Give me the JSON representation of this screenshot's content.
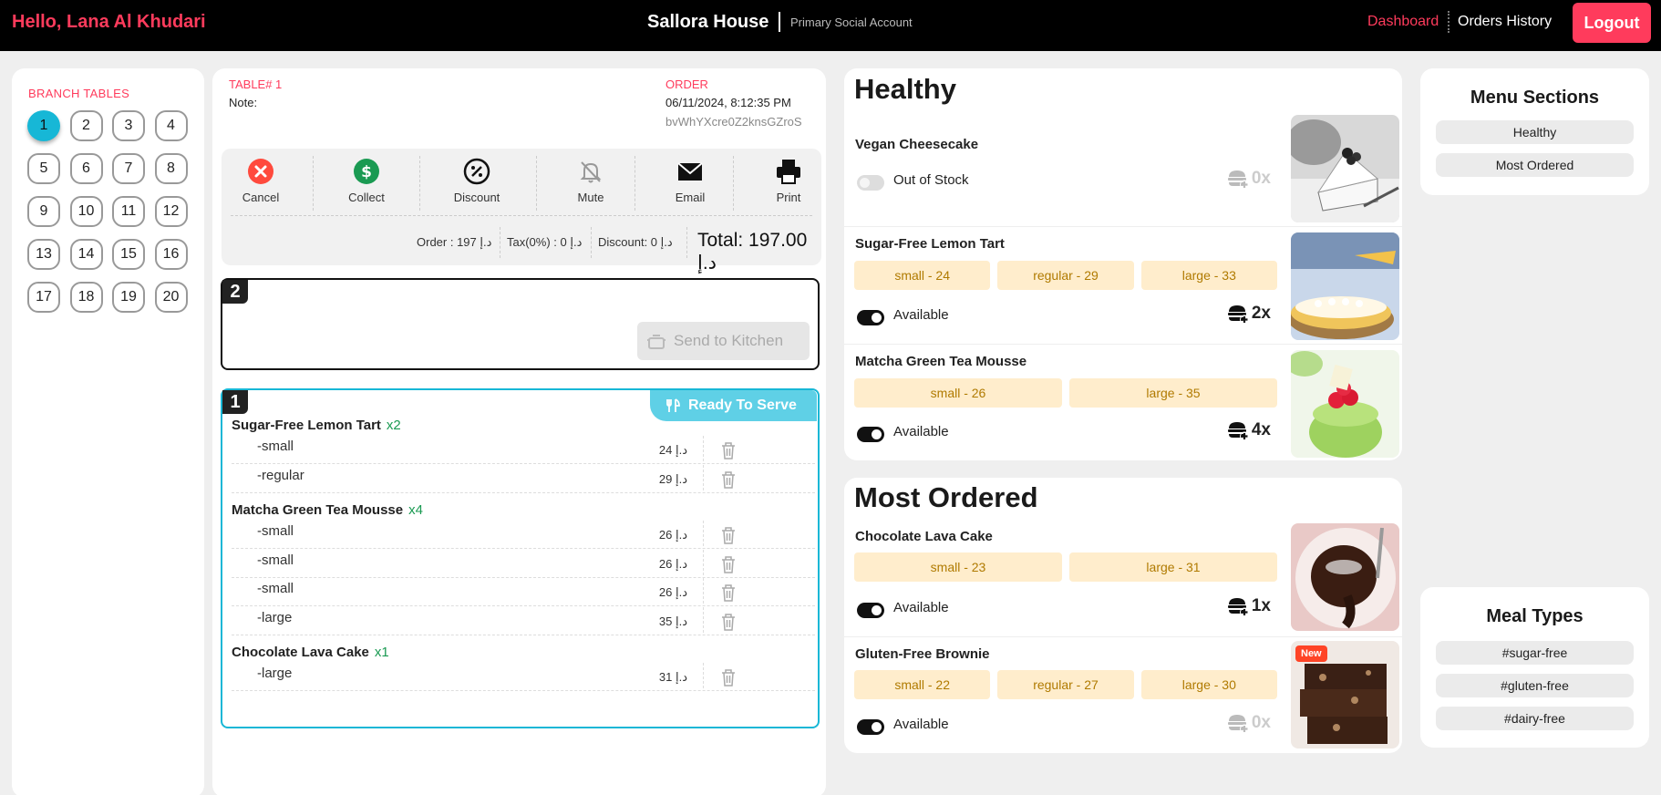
{
  "header": {
    "greeting": "Hello, Lana Al Khudari",
    "brand": "Sallora House",
    "account": "Primary Social Account",
    "nav_dashboard": "Dashboard",
    "nav_orders_history": "Orders History",
    "logout": "Logout"
  },
  "tables": {
    "title": "BRANCH TABLES",
    "items": [
      "1",
      "2",
      "3",
      "4",
      "5",
      "6",
      "7",
      "8",
      "9",
      "10",
      "11",
      "12",
      "13",
      "14",
      "15",
      "16",
      "17",
      "18",
      "19",
      "20"
    ],
    "active": "1"
  },
  "order": {
    "table_label": "TABLE# 1",
    "note_label": "Note:",
    "order_label": "ORDER",
    "date": "06/11/2024, 8:12:35 PM",
    "order_id": "bvWhYXcre0Z2knsGZroS",
    "actions": {
      "cancel": "Cancel",
      "collect": "Collect",
      "discount": "Discount",
      "mute": "Mute",
      "email": "Email",
      "print": "Print"
    },
    "totals": {
      "order": "Order : 197 د.إ",
      "tax": "Tax(0%) : 0 د.إ",
      "discount": "Discount: 0 د.إ",
      "total": "Total: 197.00 د.إ"
    },
    "pending_batch": {
      "number": "2",
      "send_label": "Send to Kitchen"
    },
    "served_batch": {
      "number": "1",
      "ready_label": "Ready To Serve",
      "items": [
        {
          "name": "Sugar-Free Lemon Tart",
          "qty": "x2",
          "options": [
            {
              "label": "-small",
              "price": "24 د.إ"
            },
            {
              "label": "-regular",
              "price": "29 د.إ"
            }
          ]
        },
        {
          "name": "Matcha Green Tea Mousse",
          "qty": "x4",
          "options": [
            {
              "label": "-small",
              "price": "26 د.إ"
            },
            {
              "label": "-small",
              "price": "26 د.إ"
            },
            {
              "label": "-small",
              "price": "26 د.إ"
            },
            {
              "label": "-large",
              "price": "35 د.إ"
            }
          ]
        },
        {
          "name": "Chocolate Lava Cake",
          "qty": "x1",
          "options": [
            {
              "label": "-large",
              "price": "31 د.إ"
            }
          ]
        }
      ]
    }
  },
  "menu": {
    "healthy": {
      "title": "Healthy",
      "items": [
        {
          "name": "Vegan Cheesecake",
          "sizes": [],
          "status": "Out of Stock",
          "available": false,
          "count": "0x",
          "image": "cheesecake-image"
        },
        {
          "name": "Sugar-Free Lemon Tart",
          "sizes": [
            "small - 24",
            "regular - 29",
            "large - 33"
          ],
          "status": "Available",
          "available": true,
          "count": "2x",
          "image": "lemon-tart-image"
        },
        {
          "name": "Matcha Green Tea Mousse",
          "sizes": [
            "small - 26",
            "large - 35"
          ],
          "status": "Available",
          "available": true,
          "count": "4x",
          "image": "matcha-mousse-image"
        }
      ]
    },
    "most_ordered": {
      "title": "Most Ordered",
      "items": [
        {
          "name": "Chocolate Lava Cake",
          "sizes": [
            "small - 23",
            "large - 31"
          ],
          "status": "Available",
          "available": true,
          "count": "1x",
          "image": "lava-cake-image"
        },
        {
          "name": "Gluten-Free Brownie",
          "sizes": [
            "small - 22",
            "regular - 27",
            "large - 30"
          ],
          "status": "Available",
          "available": true,
          "count": "0x",
          "badge": "New",
          "image": "brownie-image"
        }
      ]
    }
  },
  "menu_sections": {
    "title": "Menu Sections",
    "items": [
      "Healthy",
      "Most Ordered"
    ]
  },
  "meal_types": {
    "title": "Meal Types",
    "items": [
      "#sugar-free",
      "#gluten-free",
      "#dairy-free"
    ]
  },
  "colors": {
    "accent": "#ff3b5c",
    "active_table": "#17b7d6",
    "ready": "#5fd0e6",
    "size_chip": "#ffedcc",
    "qty_green": "#1a9a52"
  }
}
